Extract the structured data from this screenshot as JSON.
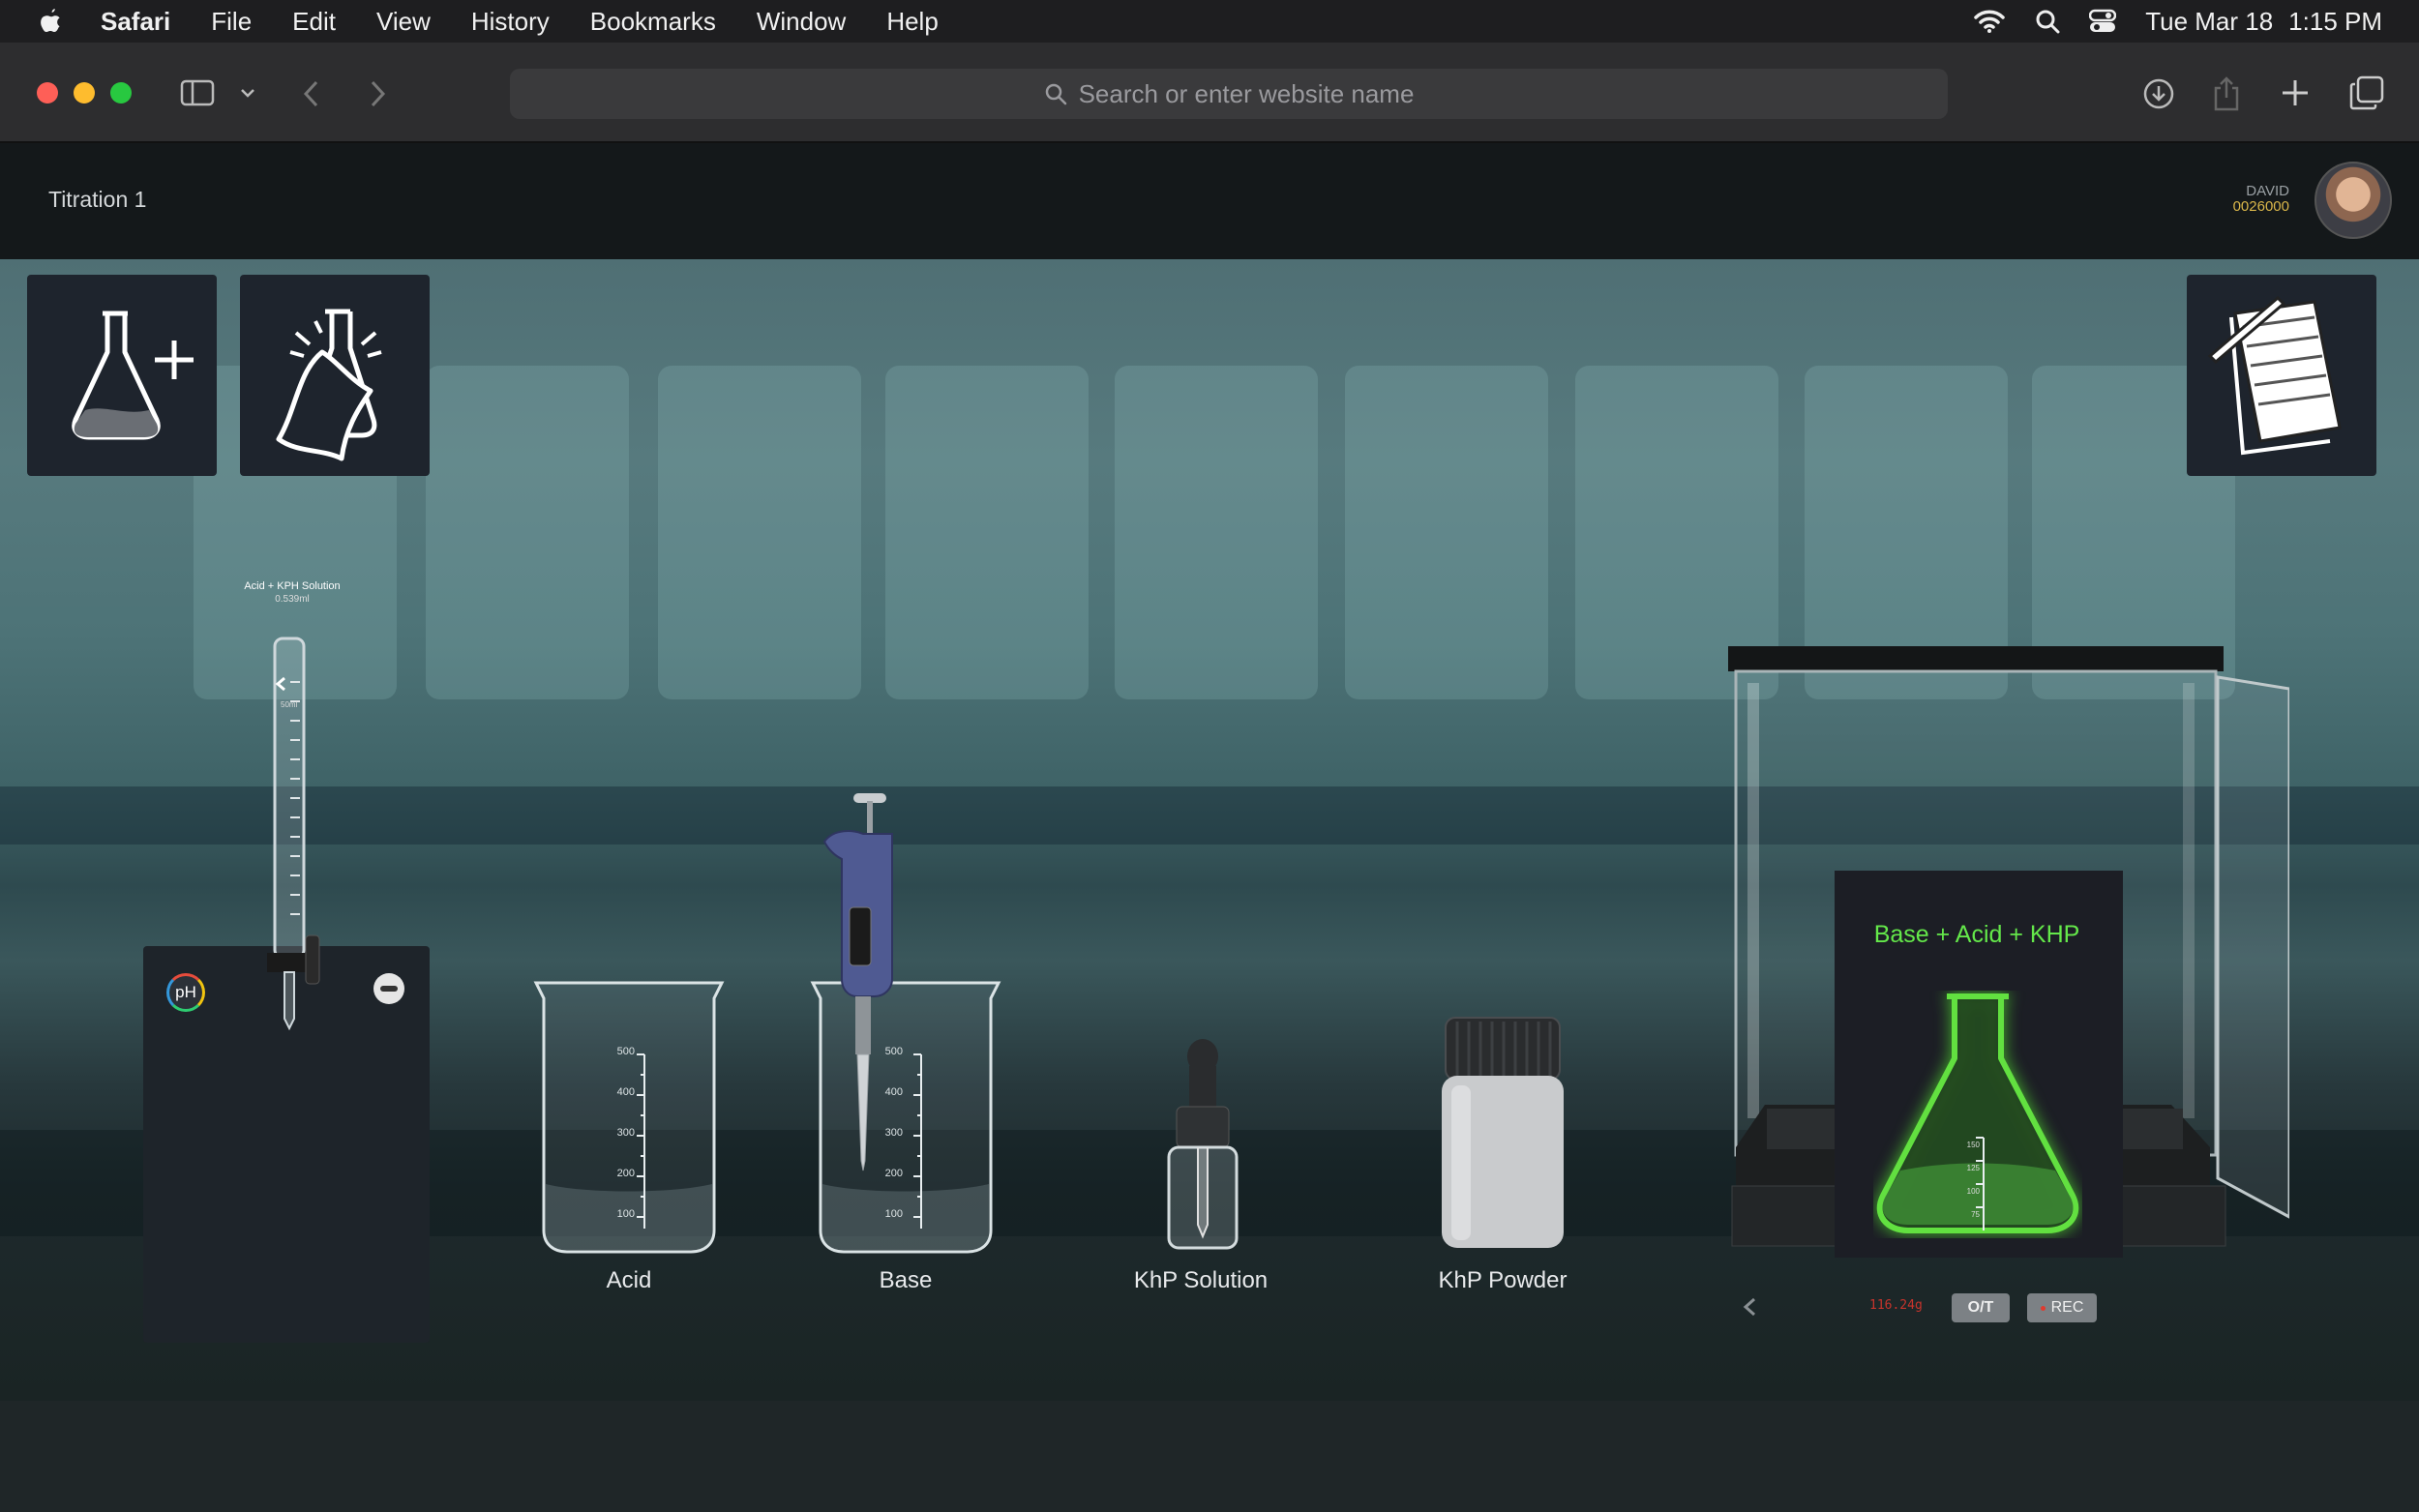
{
  "menubar": {
    "app_name": "Safari",
    "items": [
      "File",
      "Edit",
      "View",
      "History",
      "Bookmarks",
      "Window",
      "Help"
    ],
    "date": "Tue Mar 18",
    "time": "1:15 PM"
  },
  "browser": {
    "address_placeholder": "Search or enter website name"
  },
  "app": {
    "title": "Titration 1",
    "user": {
      "name": "DAVID",
      "score": "0026000"
    }
  },
  "tools": {
    "add_flask": "add-flask",
    "clean_flask": "clean-flask",
    "notebook": "notebook"
  },
  "burette": {
    "title": "Acid + KPH Solution",
    "volume": "0.539ml",
    "scale_top": "50ml",
    "ph_label": "pH"
  },
  "beaker_scale": [
    "500",
    "400",
    "300",
    "200",
    "100"
  ],
  "items": [
    {
      "label": "Acid"
    },
    {
      "label": "Base"
    },
    {
      "label": "KhP Solution"
    },
    {
      "label": "KhP Powder"
    }
  ],
  "balance": {
    "flask_label": "Base + Acid + KHP",
    "flask_scale": [
      "150",
      "125",
      "100",
      "75"
    ],
    "reading": "116.24g",
    "tare_label": "O/T",
    "rec_label": "REC"
  },
  "colors": {
    "accent_green": "#64e84a",
    "score_yellow": "#d9b64a"
  }
}
